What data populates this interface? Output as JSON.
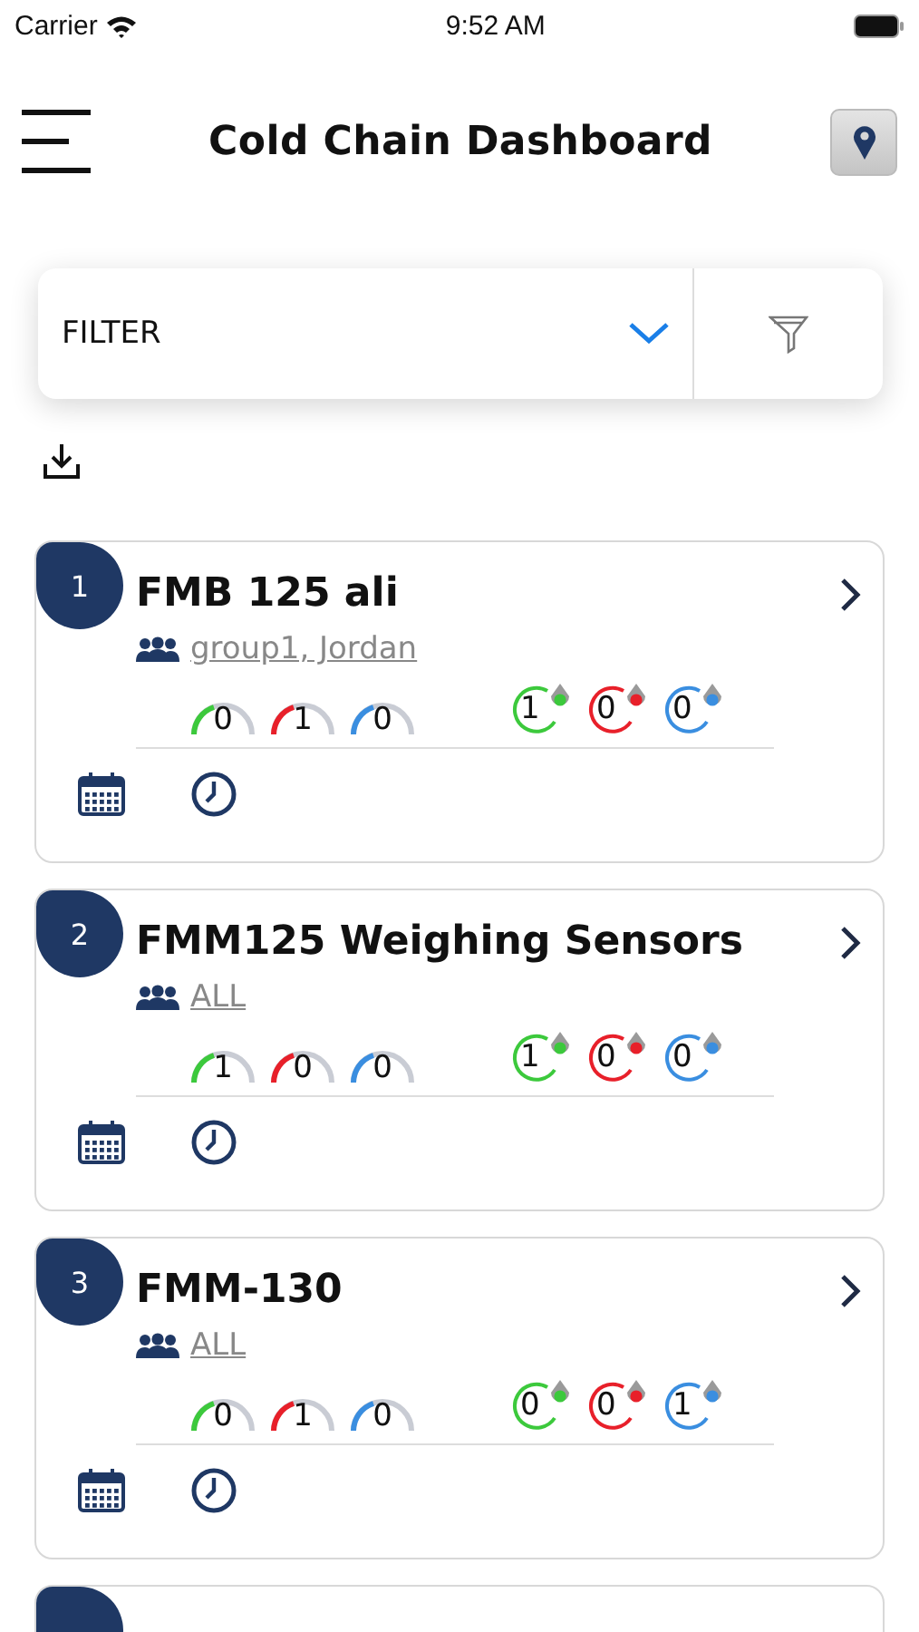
{
  "status_bar": {
    "carrier": "Carrier",
    "time": "9:52 AM"
  },
  "header": {
    "title": "Cold Chain Dashboard"
  },
  "filter": {
    "label": "FILTER"
  },
  "cards": [
    {
      "kind": "device",
      "number": "1",
      "title": "FMB 125 ali",
      "groups": "group1, Jordan",
      "gauges": [
        {
          "value": "0",
          "color": "#3cc93c"
        },
        {
          "value": "1",
          "color": "#e8202a"
        },
        {
          "value": "0",
          "color": "#3a8ee0"
        }
      ],
      "sensors": [
        {
          "value": "1",
          "color": "#3cc93c"
        },
        {
          "value": "0",
          "color": "#e8202a"
        },
        {
          "value": "0",
          "color": "#3a8ee0"
        }
      ]
    },
    {
      "kind": "device",
      "number": "2",
      "title": "FMM125 Weighing Sensors",
      "groups": "ALL",
      "gauges": [
        {
          "value": "1",
          "color": "#3cc93c"
        },
        {
          "value": "0",
          "color": "#e8202a"
        },
        {
          "value": "0",
          "color": "#3a8ee0"
        }
      ],
      "sensors": [
        {
          "value": "1",
          "color": "#3cc93c"
        },
        {
          "value": "0",
          "color": "#e8202a"
        },
        {
          "value": "0",
          "color": "#3a8ee0"
        }
      ]
    },
    {
      "kind": "device",
      "number": "3",
      "title": "FMM-130",
      "groups": "ALL",
      "gauges": [
        {
          "value": "0",
          "color": "#3cc93c"
        },
        {
          "value": "1",
          "color": "#e8202a"
        },
        {
          "value": "0",
          "color": "#3a8ee0"
        }
      ],
      "sensors": [
        {
          "value": "0",
          "color": "#3cc93c"
        },
        {
          "value": "0",
          "color": "#e8202a"
        },
        {
          "value": "1",
          "color": "#3a8ee0"
        }
      ]
    },
    {
      "kind": "cut"
    }
  ]
}
